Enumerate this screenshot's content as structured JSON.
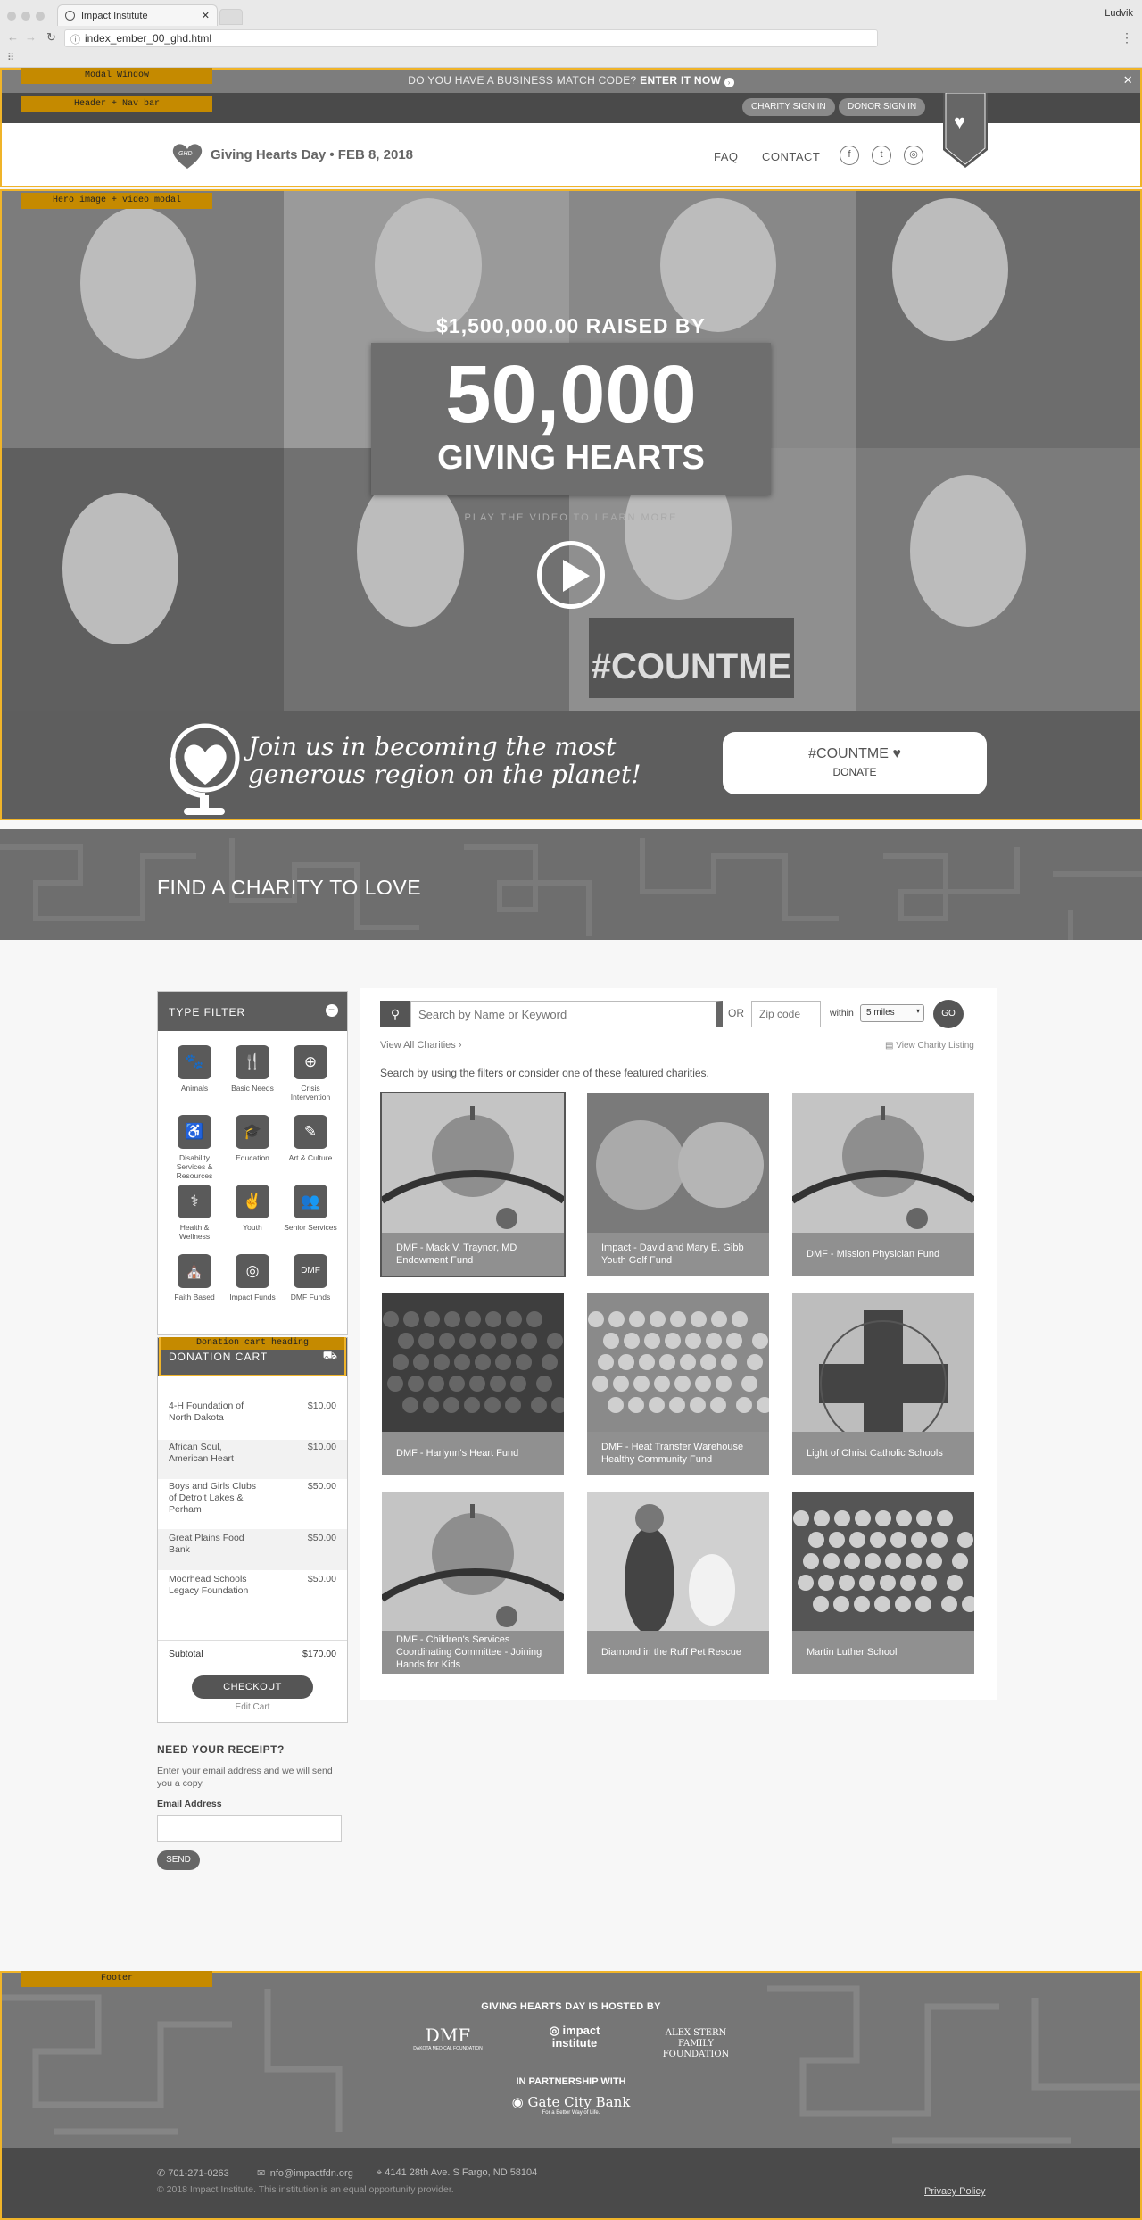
{
  "browser": {
    "tab_title": "Impact Institute",
    "url": "index_ember_00_ghd.html",
    "user": "Ludvik",
    "icons": [
      "back-icon",
      "forward-icon",
      "reload-icon",
      "menu-icon"
    ]
  },
  "annotations": {
    "modal": "Modal Window",
    "header": "Header + Nav bar",
    "hero": "Hero image + video modal",
    "cart": "Donation cart heading",
    "footer": "Footer"
  },
  "modalbar": {
    "text": "DO YOU HAVE A BUSINESS MATCH CODE?",
    "cta": "ENTER IT NOW",
    "close": "✕"
  },
  "navbar": {
    "charity_sign_in": "CHARITY SIGN IN",
    "donor_sign_in": "DONOR SIGN IN"
  },
  "header": {
    "logo": "Giving Hearts Day • FEB 8, 2018",
    "logo_badge": "GHD",
    "faq": "FAQ",
    "contact": "CONTACT",
    "social": [
      "f",
      "t",
      "◎"
    ]
  },
  "hero": {
    "raised": "$1,500,000.00 RAISED BY",
    "count": "50,000",
    "hearts": "GIVING HEARTS",
    "play_text": "PLAY THE VIDEO TO LEARN MORE",
    "sign": "#COUNTME",
    "join": "Join us in becoming the most generous region on the planet!",
    "donate_tag": "#COUNTME ♥",
    "donate_btn": "DONATE"
  },
  "band": {
    "title": "FIND A CHARITY TO LOVE"
  },
  "filter": {
    "title": "TYPE FILTER",
    "items": [
      {
        "icon": "🐾",
        "label": "Animals"
      },
      {
        "icon": "🍴",
        "label": "Basic Needs"
      },
      {
        "icon": "⊕",
        "label": "Crisis Intervention"
      },
      {
        "icon": "♿",
        "label": "Disability Services & Resources"
      },
      {
        "icon": "🎓",
        "label": "Education"
      },
      {
        "icon": "✎",
        "label": "Art & Culture"
      },
      {
        "icon": "⚕",
        "label": "Health & Wellness"
      },
      {
        "icon": "✌",
        "label": "Youth"
      },
      {
        "icon": "👥",
        "label": "Senior Services"
      },
      {
        "icon": "⛪",
        "label": "Faith Based"
      },
      {
        "icon": "◎",
        "label": "Impact Funds"
      },
      {
        "icon": "DMF",
        "label": "DMF Funds"
      }
    ]
  },
  "cart": {
    "title": "DONATION CART",
    "items": [
      {
        "name": "4-H Foundation of North Dakota",
        "amount": "$10.00"
      },
      {
        "name": "African Soul, American Heart",
        "amount": "$10.00"
      },
      {
        "name": "Boys and Girls Clubs of Detroit Lakes & Perham",
        "amount": "$50.00"
      },
      {
        "name": "Great Plains Food Bank",
        "amount": "$50.00"
      },
      {
        "name": "Moorhead Schools Legacy Foundation",
        "amount": "$50.00"
      }
    ],
    "subtotal_label": "Subtotal",
    "subtotal": "$170.00",
    "checkout": "CHECKOUT",
    "edit": "Edit Cart"
  },
  "receipt": {
    "title": "NEED YOUR RECEIPT?",
    "desc": "Enter your email address and we will send you a copy.",
    "email_label": "Email Address",
    "send": "SEND"
  },
  "search": {
    "placeholder": "Search by Name or Keyword",
    "or": "OR",
    "zip_placeholder": "Zip code",
    "within": "within",
    "radius": "5 miles",
    "go": "GO",
    "view_all": "View All Charities ›",
    "listing": "View Charity Listing",
    "hint": "Search by using the filters or consider one of these featured charities."
  },
  "charities": [
    {
      "name": "DMF - Mack V. Traynor, MD Endowment Fund",
      "img": "apple"
    },
    {
      "name": "Impact - David and Mary E. Gibb Youth Golf Fund",
      "img": "kids"
    },
    {
      "name": "DMF - Mission Physician Fund",
      "img": "apple"
    },
    {
      "name": "DMF - Harlynn's Heart Fund",
      "img": "dark"
    },
    {
      "name": "DMF - Heat Transfer Warehouse Healthy Community Fund",
      "img": "group"
    },
    {
      "name": "Light of Christ Catholic Schools",
      "img": "cross"
    },
    {
      "name": "DMF - Children's Services Coordinating Committee - Joining Hands for Kids",
      "img": "apple"
    },
    {
      "name": "Diamond in the Ruff Pet Rescue",
      "img": "dog"
    },
    {
      "name": "Martin Luther School",
      "img": "crowd"
    }
  ],
  "footer": {
    "hosted": "GIVING HEARTS DAY IS HOSTED BY",
    "partners": [
      "DAKOTA MEDICAL FOUNDATION",
      "impact institute",
      "ALEX STERN FAMILY FOUNDATION"
    ],
    "partnership": "IN PARTNERSHIP WITH",
    "bank": "Gate City Bank",
    "bank_tag": "For a Better Way of Life.",
    "phone": "701-271-0263",
    "email": "info@impactfdn.org",
    "address": "4141 28th Ave. S Fargo, ND 58104",
    "copyright": "© 2018 Impact Institute. This institution is an equal opportunity provider.",
    "privacy": "Privacy Policy"
  }
}
